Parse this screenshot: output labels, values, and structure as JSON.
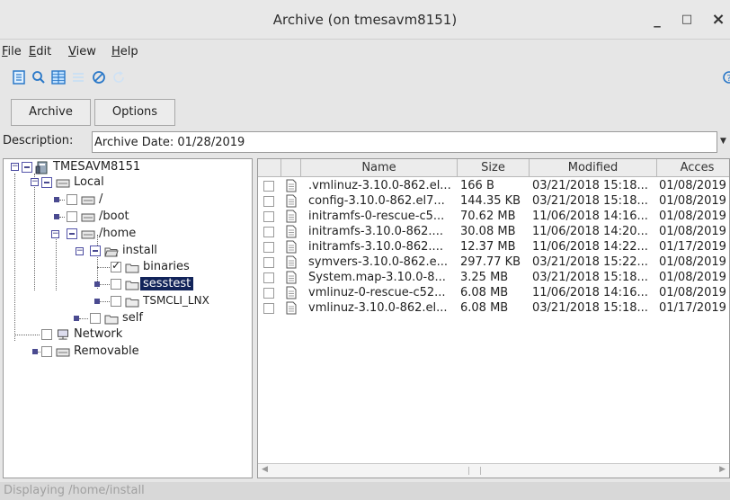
{
  "window": {
    "title": "Archive (on tmesavm8151)",
    "minimize": "_",
    "maximize": "□",
    "close": "×"
  },
  "menu": [
    {
      "pre": "",
      "ul": "F",
      "post": "ile"
    },
    {
      "pre": "",
      "ul": "E",
      "post": "dit"
    },
    {
      "pre": "",
      "ul": "V",
      "post": "iew"
    },
    {
      "pre": "",
      "ul": "H",
      "post": "elp"
    }
  ],
  "toolbar": {
    "icons": [
      "document-icon",
      "search-icon",
      "grid-icon",
      "list-icon",
      "cancel-icon",
      "refresh-icon"
    ],
    "right_icon": "help-icon"
  },
  "tabs": {
    "archive": "Archive",
    "options": "Options"
  },
  "description": {
    "label": "Description:",
    "value": "Archive Date: 01/28/2019"
  },
  "tree": {
    "root": "TMESAVM8151",
    "local": "Local",
    "slash": "/",
    "boot": "/boot",
    "home": "/home",
    "install": "install",
    "binaries": "binaries",
    "sesstest": "sesstest",
    "tsmcli": "TSMCLI_LNX",
    "self": "self",
    "network": "Network",
    "removable": "Removable"
  },
  "files": {
    "columns": {
      "name": "Name",
      "size": "Size",
      "modified": "Modified",
      "accessed": "Acces"
    },
    "rows": [
      {
        "name": ".vmlinuz-3.10.0-862.el...",
        "size": "166  B",
        "modified": "03/21/2018 15:18...",
        "accessed": "01/08/2019"
      },
      {
        "name": "config-3.10.0-862.el7...",
        "size": "144.35 KB",
        "modified": "03/21/2018 15:18...",
        "accessed": "01/08/2019"
      },
      {
        "name": "initramfs-0-rescue-c5...",
        "size": "70.62 MB",
        "modified": "11/06/2018 14:16...",
        "accessed": "01/08/2019"
      },
      {
        "name": "initramfs-3.10.0-862....",
        "size": "30.08 MB",
        "modified": "11/06/2018 14:20...",
        "accessed": "01/08/2019"
      },
      {
        "name": "initramfs-3.10.0-862....",
        "size": "12.37 MB",
        "modified": "11/06/2018 14:22...",
        "accessed": "01/17/2019"
      },
      {
        "name": "symvers-3.10.0-862.e...",
        "size": "297.77 KB",
        "modified": "03/21/2018 15:22...",
        "accessed": "01/08/2019"
      },
      {
        "name": "System.map-3.10.0-8...",
        "size": "3.25 MB",
        "modified": "03/21/2018 15:18...",
        "accessed": "01/08/2019"
      },
      {
        "name": "vmlinuz-0-rescue-c52...",
        "size": "6.08 MB",
        "modified": "11/06/2018 14:16...",
        "accessed": "01/08/2019"
      },
      {
        "name": "vmlinuz-3.10.0-862.el...",
        "size": "6.08 MB",
        "modified": "03/21/2018 15:18...",
        "accessed": "01/17/2019"
      }
    ]
  },
  "status": {
    "text": "Displaying /home/install"
  },
  "colors": {
    "accent": "#3a7dc9",
    "selection": "#12245a",
    "tree_lines": "#4a4a90"
  }
}
